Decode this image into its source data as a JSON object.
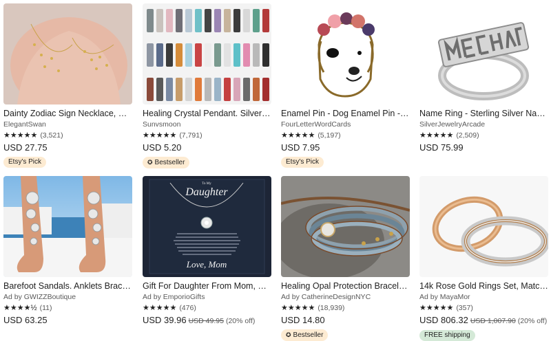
{
  "listings": [
    {
      "title": "Dainty Zodiac Sign Necklace, Con...",
      "shop": "ElegantSwan",
      "stars": "★★★★★",
      "count": "(3,521)",
      "price": "USD 27.75",
      "badge": "Etsy's Pick",
      "badge_type": "pick"
    },
    {
      "title": "Healing Crystal Pendant. Silver Cr...",
      "shop": "Sunvsmoon",
      "stars": "★★★★★",
      "count": "(7,791)",
      "price": "USD 5.20",
      "badge": "Bestseller",
      "badge_type": "best"
    },
    {
      "title": "Enamel Pin - Dog Enamel Pin - Dog...",
      "shop": "FourLetterWordCards",
      "stars": "★★★★★",
      "count": "(5,197)",
      "price": "USD 7.95",
      "badge": "Etsy's Pick",
      "badge_type": "pick"
    },
    {
      "title": "Name Ring - Sterling Silver Name ...",
      "shop": "SilverJewelryArcade",
      "stars": "★★★★★",
      "count": "(2,509)",
      "price": "USD 75.99"
    },
    {
      "title": "Barefoot Sandals. Anklets Bracelet...",
      "shop": "Ad by GWIZZBoutique",
      "stars": "★★★★½",
      "count": "(11)",
      "price": "USD 63.25"
    },
    {
      "title": "Gift For Daughter From Mom, Dau...",
      "shop": "Ad by EmporioGifts",
      "stars": "★★★★★",
      "count": "(476)",
      "price": "USD 39.96",
      "was": "USD 49.95",
      "off": "(20% off)"
    },
    {
      "title": "Healing Opal Protection Bracelet-...",
      "shop": "Ad by CatherineDesignNYC",
      "stars": "★★★★★",
      "count": "(18,939)",
      "price": "USD 14.80",
      "badge": "Bestseller",
      "badge_type": "best"
    },
    {
      "title": "14k Rose Gold Rings Set, Matchin...",
      "shop": "Ad by MayaMor",
      "stars": "★★★★★",
      "count": "(357)",
      "price": "USD 806.32",
      "was": "USD 1,007.90",
      "off": "(20% off)",
      "badge": "FREE shipping",
      "badge_type": "ship"
    }
  ],
  "images": {
    "daughter_card_small": "To My",
    "daughter_card_title": "Daughter",
    "daughter_card_sign": "Love, Mom"
  },
  "colors": {
    "badge_pick": "#fdebd2",
    "badge_ship": "#d4e9d7",
    "star": "#222222"
  },
  "icons": {
    "bestseller": "award-icon"
  }
}
